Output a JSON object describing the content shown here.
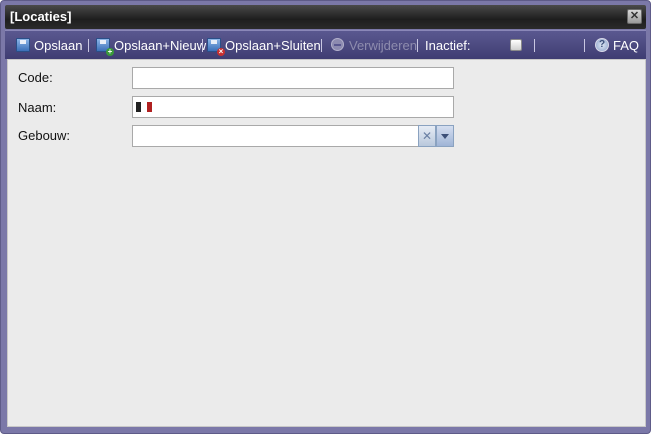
{
  "window": {
    "title": "[Locaties]"
  },
  "toolbar": {
    "save_label": "Opslaan",
    "save_new_label": "Opslaan+Nieuw",
    "save_close_label": "Opslaan+Sluiten",
    "delete_label": "Verwijderen",
    "inactive_label": "Inactief:",
    "faq_label": "FAQ"
  },
  "form": {
    "code": {
      "label": "Code:",
      "value": ""
    },
    "name": {
      "label": "Naam:",
      "value": ""
    },
    "building": {
      "label": "Gebouw:",
      "value": ""
    }
  },
  "colors": {
    "accent": "#3f3d72",
    "frame": "#7b78a8",
    "titlebar": "#1e1e1e",
    "content_bg": "#ebebeb"
  }
}
